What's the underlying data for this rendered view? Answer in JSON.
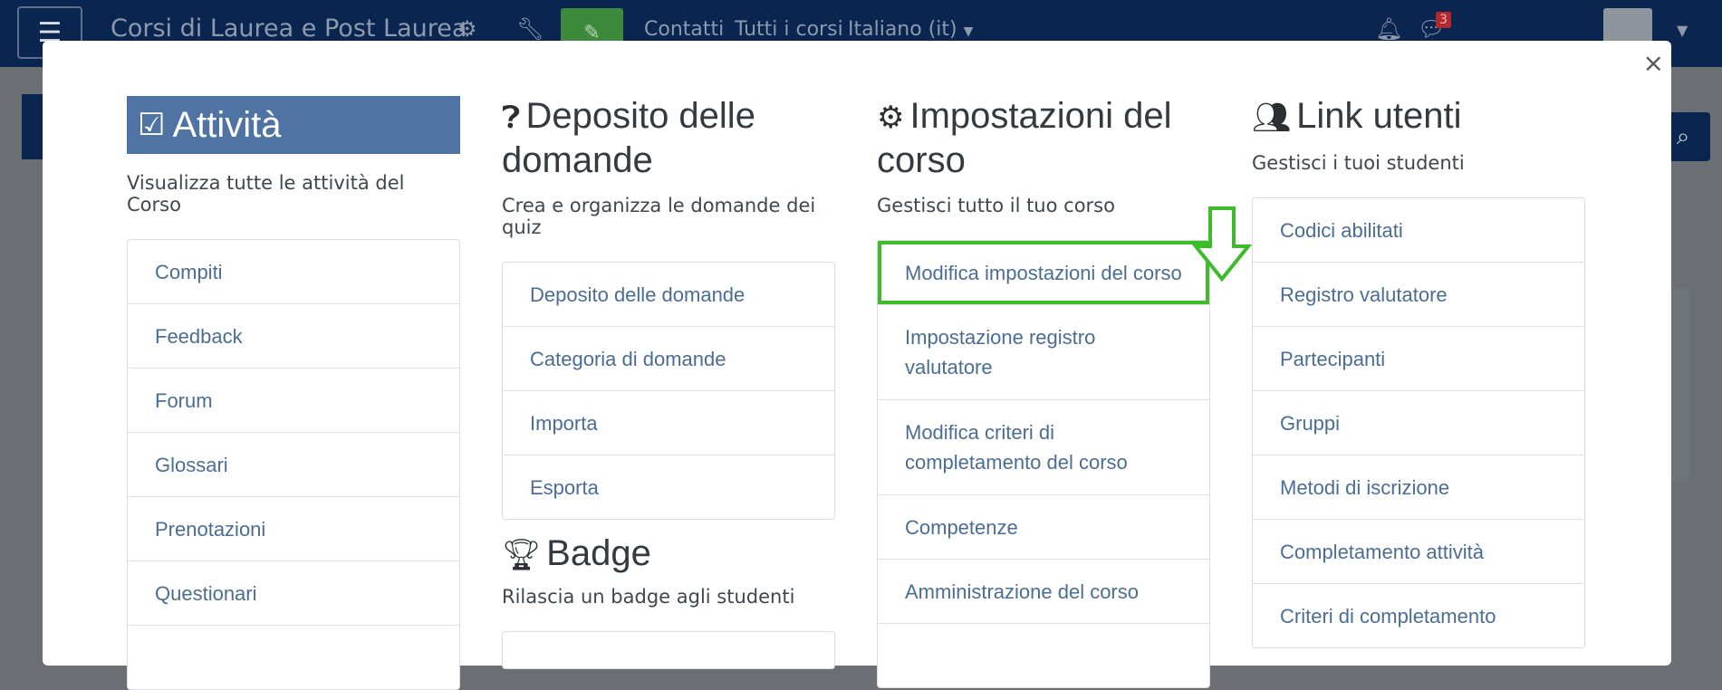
{
  "navbar": {
    "menu_icon": "hamburger-icon",
    "brand": "Corsi di Laurea e Post Laurea",
    "links": [
      "Contatti",
      "Tutti i corsi"
    ],
    "language": "Italiano (it)",
    "notification_icon": "bell-icon",
    "messages_icon": "chat-icon",
    "messages_count": "3"
  },
  "modal": {
    "close_label": "×",
    "columns": [
      {
        "title": "Attività",
        "icon": "check-square-icon",
        "description": "Visualizza tutte le attività del Corso",
        "items": [
          "Compiti",
          "Feedback",
          "Forum",
          "Glossari",
          "Prenotazioni",
          "Questionari"
        ]
      },
      {
        "title": "Deposito delle domande",
        "icon": "question-circle-icon",
        "description": "Crea e organizza le domande dei quiz",
        "items": [
          "Deposito delle domande",
          "Categoria di domande",
          "Importa",
          "Esporta"
        ]
      },
      {
        "title": "Impostazioni del corso",
        "icon": "gears-icon",
        "description": "Gestisci tutto il tuo corso",
        "items": [
          "Modifica impostazioni del corso",
          "Impostazione registro valutatore",
          "Modifica criteri di completamento del corso",
          "Competenze",
          "Amministrazione del corso"
        ]
      },
      {
        "title": "Link utenti",
        "icon": "users-icon",
        "description": "Gestisci i tuoi studenti",
        "items": [
          "Codici abilitati",
          "Registro valutatore",
          "Partecipanti",
          "Gruppi",
          "Metodi di iscrizione",
          "Completamento attività",
          "Criteri di completamento"
        ]
      }
    ],
    "badge_section": {
      "title": "Badge",
      "icon": "trophy-icon",
      "description": "Rilascia un badge agli studenti"
    }
  },
  "colors": {
    "navbar": "#0a2650",
    "highlight": "#3dbb2b",
    "link": "#4a6d96",
    "attivita_header": "#4f73a3"
  }
}
